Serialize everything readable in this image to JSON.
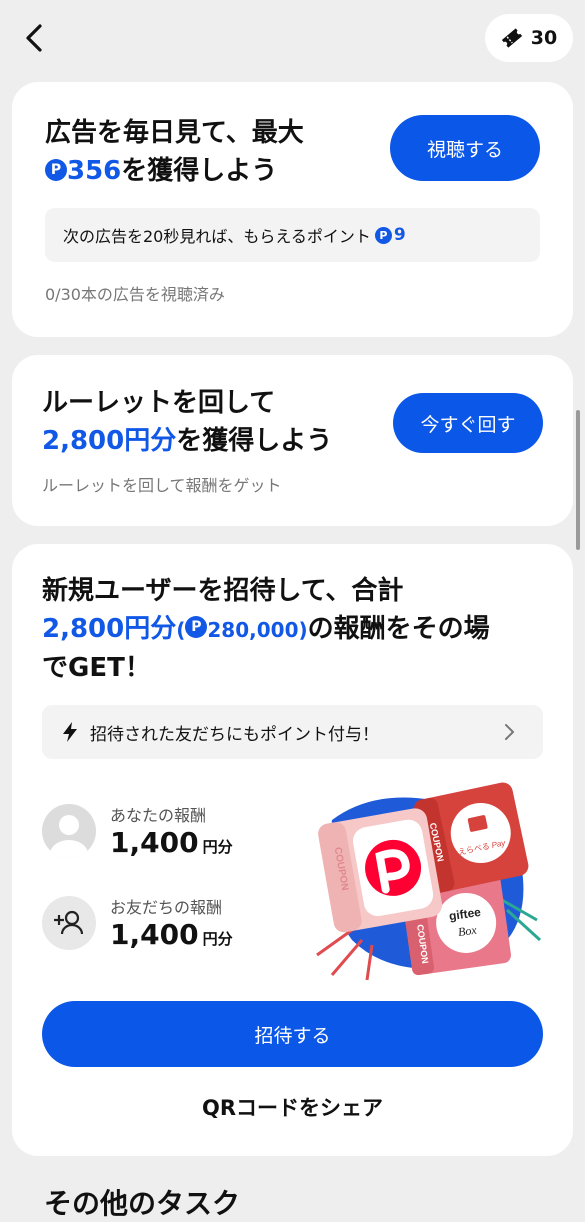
{
  "header": {
    "points": "30"
  },
  "ad_card": {
    "title_line1": "広告を毎日見て、最大",
    "coin_symbol": "P",
    "title_amount": "356",
    "title_suffix": "を獲得しよう",
    "button_label": "視聴する",
    "info_text": "次の広告を20秒見れば、もらえるポイント",
    "info_points": "9",
    "progress_text": "0/30本の広告を視聴済み",
    "watched": 0,
    "total": 30
  },
  "roulette_card": {
    "title_line1": "ルーレットを回して",
    "title_amount": "2,800円分",
    "title_suffix": "を獲得しよう",
    "button_label": "今すぐ回す",
    "subtitle": "ルーレットを回して報酬をゲット"
  },
  "invite_card": {
    "title_line1": "新規ユーザーを招待して、合計",
    "title_amount": "2,800円分",
    "title_paren_open": "(",
    "title_points": "280,000",
    "title_paren_close": ")",
    "title_suffix": "の報酬をその場",
    "title_line3": "でGET！",
    "banner_text": "招待された友だちにもポイント付与！",
    "my_reward_label": "あなたの報酬",
    "my_reward_value": "1,400",
    "my_reward_unit": "円分",
    "friend_reward_label": "お友だちの報酬",
    "friend_reward_value": "1,400",
    "friend_reward_unit": "円分",
    "coupon_label_1": "COUPON",
    "coupon_label_2": "COUPON",
    "coupon_label_3": "COUPON",
    "erabe_pay_text": "えらべる",
    "erabe_pay_brand": "Pay",
    "giftee_brand": "giftee",
    "giftee_box": "Box",
    "invite_button_label": "招待する",
    "qr_share_label": "QRコードをシェア"
  },
  "next_section": {
    "title": "その他のタスク"
  },
  "colors": {
    "accent": "#0b57e8",
    "accent_text": "#1258e6",
    "background": "#eeeeee"
  }
}
